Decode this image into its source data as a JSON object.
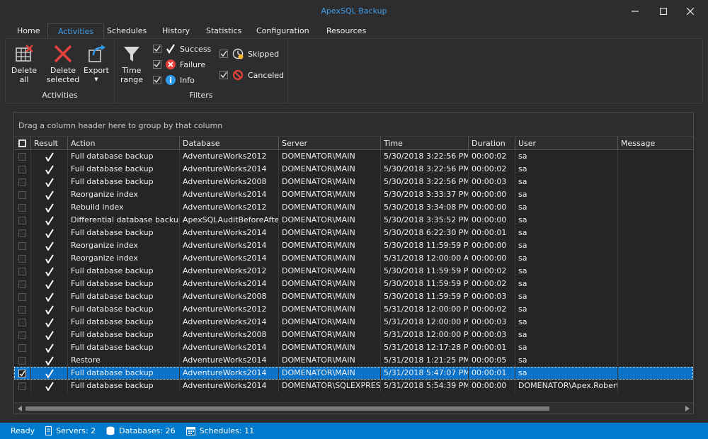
{
  "window": {
    "title": "ApexSQL Backup"
  },
  "tabs": [
    {
      "label": "Home"
    },
    {
      "label": "Activities"
    },
    {
      "label": "Schedules"
    },
    {
      "label": "History"
    },
    {
      "label": "Statistics"
    },
    {
      "label": "Configuration"
    },
    {
      "label": "Resources"
    }
  ],
  "active_tab": "Activities",
  "ribbon": {
    "activities_group": {
      "label": "Activities",
      "delete_all": "Delete\nall",
      "delete_selected": "Delete\nselected",
      "export": "Export"
    },
    "filters_group": {
      "label": "Filters",
      "time_range": "Time\nrange",
      "success": "Success",
      "failure": "Failure",
      "info": "Info",
      "skipped": "Skipped",
      "canceled": "Canceled"
    }
  },
  "grid": {
    "group_panel_text": "Drag a column header here to group by that column",
    "columns": [
      "Result",
      "Action",
      "Database",
      "Server",
      "Time",
      "Duration",
      "User",
      "Message"
    ],
    "rows": [
      {
        "action": "Full database backup",
        "database": "AdventureWorks2012",
        "server": "DOMENATOR\\MAIN",
        "time": "5/30/2018 3:22:56 PM",
        "duration": "00:00:02",
        "user": "sa",
        "message": ""
      },
      {
        "action": "Full database backup",
        "database": "AdventureWorks2014",
        "server": "DOMENATOR\\MAIN",
        "time": "5/30/2018 3:22:56 PM",
        "duration": "00:00:02",
        "user": "sa",
        "message": ""
      },
      {
        "action": "Full database backup",
        "database": "AdventureWorks2008",
        "server": "DOMENATOR\\MAIN",
        "time": "5/30/2018 3:22:56 PM",
        "duration": "00:00:03",
        "user": "sa",
        "message": ""
      },
      {
        "action": "Reorganize index",
        "database": "AdventureWorks2014",
        "server": "DOMENATOR\\MAIN",
        "time": "5/30/2018 3:33:37 PM",
        "duration": "00:00:00",
        "user": "sa",
        "message": ""
      },
      {
        "action": "Rebuild index",
        "database": "AdventureWorks2012",
        "server": "DOMENATOR\\MAIN",
        "time": "5/30/2018 3:34:08 PM",
        "duration": "00:00:00",
        "user": "sa",
        "message": ""
      },
      {
        "action": "Differential database backup",
        "database": "ApexSQLAuditBeforeAfter",
        "server": "DOMENATOR\\MAIN",
        "time": "5/30/2018 3:35:52 PM",
        "duration": "00:00:00",
        "user": "sa",
        "message": ""
      },
      {
        "action": "Full database backup",
        "database": "AdventureWorks2014",
        "server": "DOMENATOR\\MAIN",
        "time": "5/30/2018 6:22:30 PM",
        "duration": "00:00:01",
        "user": "sa",
        "message": ""
      },
      {
        "action": "Reorganize index",
        "database": "AdventureWorks2014",
        "server": "DOMENATOR\\MAIN",
        "time": "5/30/2018 11:59:59 PM",
        "duration": "00:00:00",
        "user": "sa",
        "message": ""
      },
      {
        "action": "Reorganize index",
        "database": "AdventureWorks2014",
        "server": "DOMENATOR\\MAIN",
        "time": "5/31/2018 12:00:00 AM",
        "duration": "00:00:00",
        "user": "sa",
        "message": ""
      },
      {
        "action": "Full database backup",
        "database": "AdventureWorks2012",
        "server": "DOMENATOR\\MAIN",
        "time": "5/30/2018 11:59:59 PM",
        "duration": "00:00:02",
        "user": "sa",
        "message": ""
      },
      {
        "action": "Full database backup",
        "database": "AdventureWorks2014",
        "server": "DOMENATOR\\MAIN",
        "time": "5/30/2018 11:59:59 PM",
        "duration": "00:00:02",
        "user": "sa",
        "message": ""
      },
      {
        "action": "Full database backup",
        "database": "AdventureWorks2008",
        "server": "DOMENATOR\\MAIN",
        "time": "5/30/2018 11:59:59 PM",
        "duration": "00:00:03",
        "user": "sa",
        "message": ""
      },
      {
        "action": "Full database backup",
        "database": "AdventureWorks2012",
        "server": "DOMENATOR\\MAIN",
        "time": "5/31/2018 12:00:00 PM",
        "duration": "00:00:02",
        "user": "sa",
        "message": ""
      },
      {
        "action": "Full database backup",
        "database": "AdventureWorks2014",
        "server": "DOMENATOR\\MAIN",
        "time": "5/31/2018 12:00:00 PM",
        "duration": "00:00:03",
        "user": "sa",
        "message": ""
      },
      {
        "action": "Full database backup",
        "database": "AdventureWorks2008",
        "server": "DOMENATOR\\MAIN",
        "time": "5/31/2018 12:00:00 PM",
        "duration": "00:00:03",
        "user": "sa",
        "message": ""
      },
      {
        "action": "Full database backup",
        "database": "AdventureWorks2014",
        "server": "DOMENATOR\\MAIN",
        "time": "5/31/2018 12:17:28 PM",
        "duration": "00:00:01",
        "user": "sa",
        "message": ""
      },
      {
        "action": "Restore",
        "database": "AdventureWorks2014",
        "server": "DOMENATOR\\MAIN",
        "time": "5/31/2018 1:21:25 PM",
        "duration": "00:00:05",
        "user": "sa",
        "message": ""
      },
      {
        "action": "Full database backup",
        "database": "AdventureWorks2014",
        "server": "DOMENATOR\\MAIN",
        "time": "5/31/2018 5:47:07 PM",
        "duration": "00:00:01",
        "user": "sa",
        "message": "",
        "selected": true
      },
      {
        "action": "Full database backup",
        "database": "AdventureWorks2014",
        "server": "DOMENATOR\\SQLEXPRESS",
        "time": "5/31/2018 5:54:39 PM",
        "duration": "00:00:00",
        "user": "DOMENATOR\\Apex.Robert",
        "message": ""
      }
    ]
  },
  "statusbar": {
    "ready": "Ready",
    "servers": "Servers: 2",
    "databases": "Databases: 26",
    "schedules": "Schedules: 11"
  },
  "colors": {
    "accent": "#007acc",
    "title_text": "#3f9ee6",
    "selected_row": "#0a72c8",
    "background": "#2d2d30"
  },
  "icons": {
    "delete_all": "delete-all-grid-icon",
    "delete_selected": "red-x-icon",
    "export": "export-arrow-icon",
    "time_range": "funnel-icon",
    "success": "checkmark-icon",
    "failure": "red-x-circle-icon",
    "info": "info-circle-icon",
    "skipped": "skipped-clock-icon",
    "canceled": "canceled-circle-icon"
  }
}
